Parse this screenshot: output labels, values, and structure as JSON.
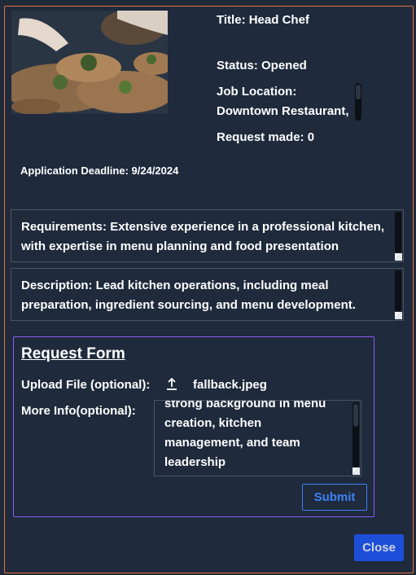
{
  "job": {
    "title": "Title: Head Chef",
    "status": "Status: Opened",
    "location": "Job Location: Downtown Restaurant,",
    "requests": "Request made: 0",
    "deadline": "Application Deadline: 9/24/2024"
  },
  "photo_description": "chef-plating-dishes",
  "requirements": "Requirements: Extensive experience in a professional kitchen, with expertise in menu planning and food presentation",
  "description": "Description:  Lead kitchen operations, including meal preparation, ingredient sourcing, and menu development.",
  "form": {
    "title": "Request Form",
    "upload_label": "Upload File (optional):",
    "file_name": "fallback.jpeg",
    "more_label": "More Info(optional):",
    "more_text": "strong background in menu\ncreation, kitchen\nmanagement, and team\nleadership",
    "submit_label": "Submit"
  },
  "close_label": "Close",
  "colors": {
    "accent": "#3b82f6",
    "close_bg": "#1d4ed8",
    "border_orange": "#e2713f",
    "border_purple": "#8b5cf6"
  }
}
